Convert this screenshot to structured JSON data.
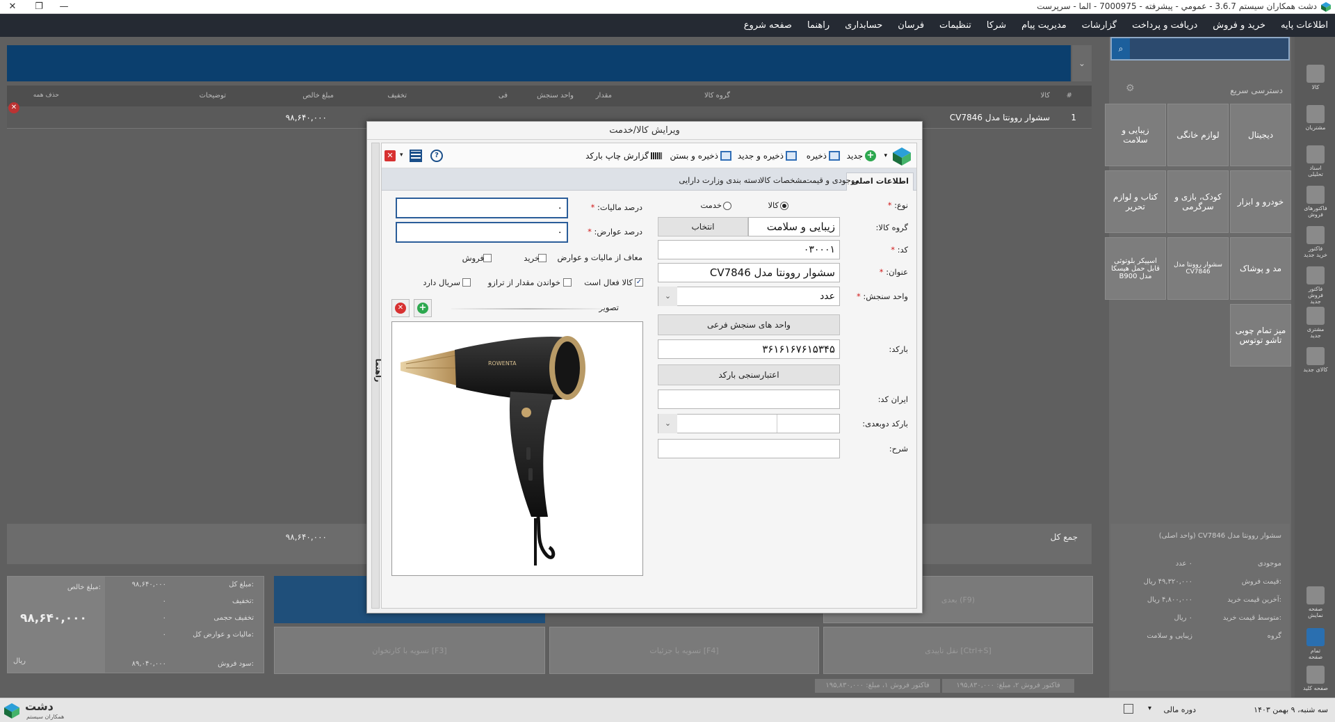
{
  "window": {
    "title": "دشت همکاران سیستم 3.6.7 - عمومي - پيشرفته - 7000975 - الما - سرپرست",
    "close_glyph": "✕",
    "restore_glyph": "❐",
    "minimize_glyph": "—"
  },
  "menu": [
    "اطلاعات پایه",
    "خرید و فروش",
    "دریافت و پرداخت",
    "گزارشات",
    "مدیریت پیام",
    "شرکا",
    "تنظیمات",
    "فرسان",
    "حسابداری",
    "راهنما",
    "صفحه شروع"
  ],
  "background": {
    "grid_headers": [
      "#",
      "کالا",
      "گروه کالا",
      "مقدار",
      "واحد سنجش",
      "فی",
      "تخفیف",
      "مبلغ خالص",
      "توضیحات",
      "حذف همه"
    ],
    "row": {
      "index": "1",
      "product": "سشوار روونتا مدل CV7846",
      "net_amount": "۹۸,۶۴۰,۰۰۰"
    },
    "sum_label": "جمع کل",
    "sum_value": "۹۸,۶۴۰,۰۰۰",
    "quick_access_title": "دسترسی سریع",
    "quick_tiles": [
      "دیجیتال",
      "لوازم خانگی",
      "زیبایی و سلامت",
      "خودرو و ابزار",
      "کودک، بازی و سرگرمی",
      "کتاب و لوازم تحریر",
      "مد و پوشاک",
      "سشوار روونتا مدل CV7846",
      "اسپیکر بلوتوثی قابل حمل هیسکا مدل B900",
      "میز تمام چوبی تاشو توتوس"
    ],
    "side_icons": [
      "کالا",
      "مشتریان",
      "اسناد تحلیلی",
      "فاکتورهای فروش",
      "فاکتور خرید جدید",
      "فاکتور فروش جدید",
      "مشتری جدید",
      "کالای جدید",
      "صفحه نمایش",
      "تمام صفحه",
      "صفحه کلید"
    ],
    "product_panel_title": "سشوار روونتا مدل CV7846 (واحد اصلی)",
    "product_panel_rows": [
      {
        "label": "موجودی",
        "value": "۰ عدد"
      },
      {
        "label": "قیمت فروش:",
        "value": "۴۹,۳۲۰,۰۰۰ ریال"
      },
      {
        "label": "آخرین قیمت خرید:",
        "value": "۴,۸۰۰,۰۰۰ ریال"
      },
      {
        "label": "متوسط قیمت خرید:",
        "value": "۰ ریال"
      },
      {
        "label": "گروه",
        "value": "زیبایی و سلامت"
      }
    ],
    "totals": [
      {
        "label": "مبلغ کل:",
        "value": "۹۸,۶۴۰,۰۰۰"
      },
      {
        "label": "تخفیف:",
        "value": "۰"
      },
      {
        "label": "تخفیف حجمی",
        "value": "۰"
      },
      {
        "label": "مالیات و عوارض کل:",
        "value": "۰"
      },
      {
        "label": "سود فروش:",
        "value": "۸۹,۰۴۰,۰۰۰"
      }
    ],
    "net_label": "مبلغ خالص:",
    "net_big": "۹۸,۶۴۰,۰۰۰",
    "net_currency": "ریال",
    "action_buttons": [
      "تسویه با کارتخوان [F3]",
      "تسویه با جزئیات [F4]",
      "بعدی (F9)",
      "نقل تاییدی [Ctrl+S]"
    ],
    "invoice_tabs": [
      "فاکتور فروش ۲، مبلغ: ۱۹۵,۸۳۰,۰۰۰",
      "فاکتور فروش ۱، مبلغ: ۱۹۵,۸۳۰,۰۰۰"
    ]
  },
  "statusbar": {
    "date": "سه شنبه، ۹ بهمن ۱۴۰۳",
    "fiscal": "دوره مالی",
    "brand": "دشت",
    "brand_sub": "همکاران سیستم"
  },
  "dialog": {
    "title": "ویرایش کالا/خدمت",
    "guide_label": "راهنما",
    "toolbar": {
      "new": "جدید",
      "save": "ذخیره",
      "save_new": "ذخیره و جدید",
      "save_close": "ذخیره و بستن",
      "barcode_report": "گزارش چاپ بارکد"
    },
    "tabs": [
      "اطلاعات اصلی",
      "موجودی و قیمت",
      "مشخصات کالا",
      "دسته بندی وزارت دارایی"
    ],
    "form": {
      "type_label": "نوع:",
      "type_goods": "کالا",
      "type_service": "خدمت",
      "group_label": "گروه کالا:",
      "group_value": "زیبایی و سلامت",
      "group_select": "انتخاب",
      "code_label": "کد:",
      "code_value": "۰۳۰۰۰۱",
      "name_label": "عنوان:",
      "name_value": "سشوار روونتا مدل CV7846",
      "unit_label": "واحد سنجش:",
      "unit_value": "عدد",
      "sub_units": "واحد های سنجش فرعی",
      "barcode_label": "بارکد:",
      "barcode_value": "۳۶۱۶۱۶۷۶۱۵۳۴۵",
      "barcode_validate": "اعتبارسنجی بارکد",
      "iran_code_label": "ایران کد:",
      "iran_code_value": "",
      "barcode2d_label": "بارکد دوبعدی:",
      "desc_label": "شرح:",
      "desc_value": "",
      "tax_label": "درصد مالیات:",
      "tax_value": "۰",
      "duty_label": "درصد عوارض:",
      "duty_value": "۰",
      "exempt_label": "معاف از مالیات و عوارض",
      "exempt_buy": "خرید",
      "exempt_sell": "فروش",
      "active_label": "کالا فعال است",
      "scale_label": "خواندن مقدار از ترازو",
      "serial_label": "سریال دارد",
      "image_label": "تصویر",
      "image_brand": "ROWENTA"
    }
  }
}
